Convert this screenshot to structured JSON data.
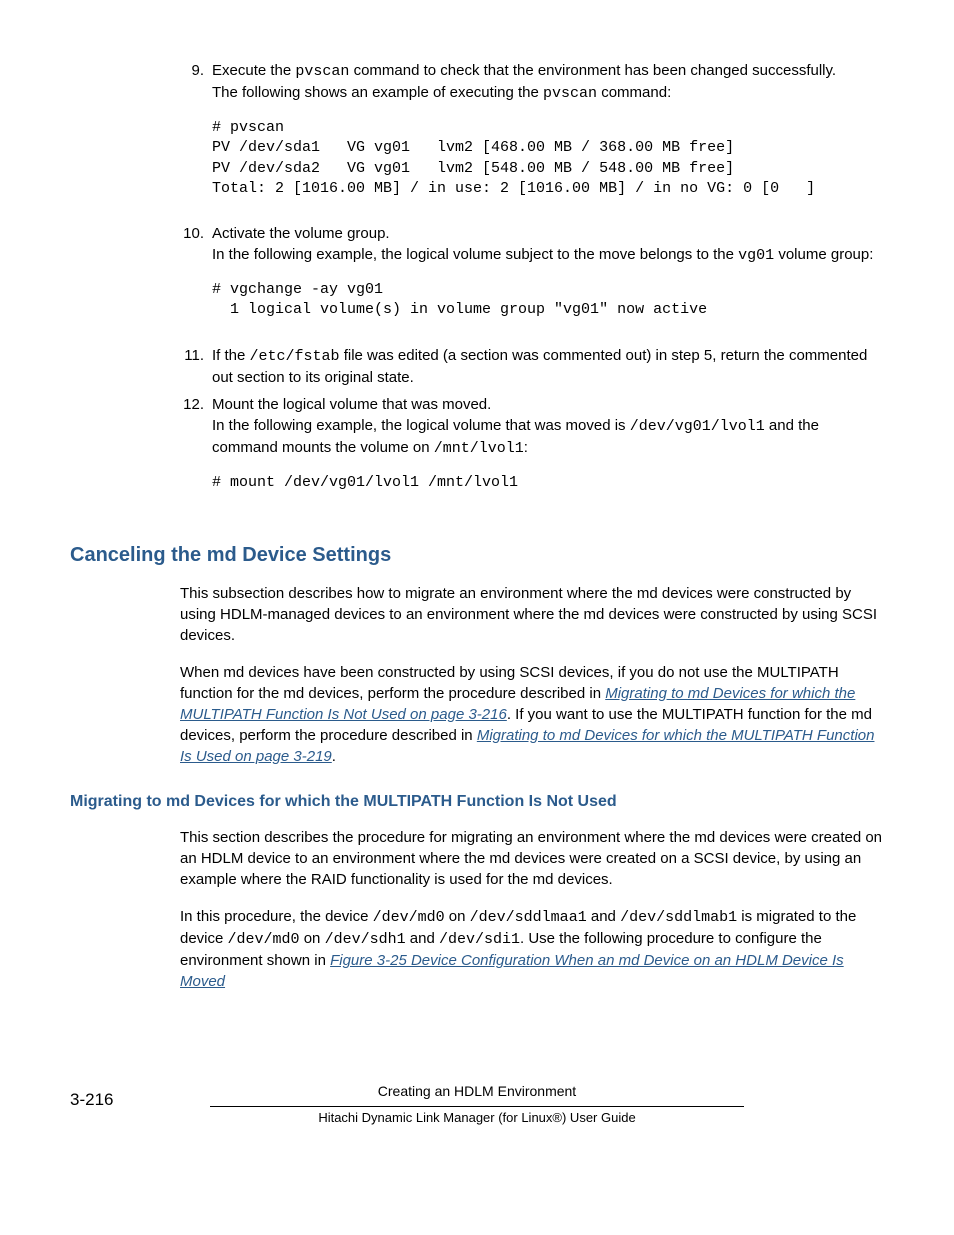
{
  "steps": {
    "s9": {
      "num": "9.",
      "p1a": "Execute the ",
      "p1code": "pvscan",
      "p1b": " command to check that the environment has been changed successfully.",
      "p2a": "The following shows an example of executing the ",
      "p2code": "pvscan",
      "p2b": " command:",
      "code": "# pvscan\nPV /dev/sda1   VG vg01   lvm2 [468.00 MB / 368.00 MB free]\nPV /dev/sda2   VG vg01   lvm2 [548.00 MB / 548.00 MB free]\nTotal: 2 [1016.00 MB] / in use: 2 [1016.00 MB] / in no VG: 0 [0   ]"
    },
    "s10": {
      "num": "10.",
      "p1": "Activate the volume group.",
      "p2a": "In the following example, the logical volume subject to the move belongs to the ",
      "p2code": "vg01",
      "p2b": " volume group:",
      "code": "# vgchange -ay vg01\n  1 logical volume(s) in volume group \"vg01\" now active"
    },
    "s11": {
      "num": "11.",
      "p1a": "If the ",
      "p1code": "/etc/fstab",
      "p1b": " file was edited (a section was commented out) in step 5, return the commented out section to its original state."
    },
    "s12": {
      "num": "12.",
      "p1": "Mount the logical volume that was moved.",
      "p2a": "In the following example, the logical volume that was moved is ",
      "p2code1": "/dev/vg01/lvol1",
      "p2b": " and the command mounts the volume on ",
      "p2code2": "/mnt/lvol1",
      "p2c": ":",
      "code": "# mount /dev/vg01/lvol1 /mnt/lvol1"
    }
  },
  "section": {
    "title": "Canceling the md Device Settings",
    "p1": "This subsection describes how to migrate an environment where the md devices were constructed by using HDLM-managed devices to an environment where the md devices were constructed by using SCSI devices.",
    "p2a": "When md devices have been constructed by using SCSI devices, if you do not use the MULTIPATH function for the md devices, perform the procedure described in ",
    "link1": "Migrating to md Devices for which the MULTIPATH Function Is Not Used on page 3-216",
    "p2b": ". If you want to use the MULTIPATH function for the md devices, perform the procedure described in ",
    "link2": "Migrating to md Devices for which the MULTIPATH Function Is Used on page 3-219",
    "p2c": "."
  },
  "subsection": {
    "title": "Migrating to md Devices for which the MULTIPATH Function Is Not Used",
    "p1": "This section describes the procedure for migrating an environment where the md devices were created on an HDLM device to an environment where the md devices were created on a SCSI device, by using an example where the RAID functionality is used for the md devices.",
    "p2a": "In this procedure, the device ",
    "c1": "/dev/md0",
    "p2b": " on ",
    "c2": "/dev/sddlmaa1",
    "p2c": " and ",
    "c3": "/dev/sddlmab1",
    "p2d": " is migrated to the device ",
    "c4": "/dev/md0",
    "p2e": " on ",
    "c5": "/dev/sdh1",
    "p2f": " and ",
    "c6": "/dev/sdi1",
    "p2g": ". Use the following procedure to configure the environment shown in ",
    "link": "Figure 3-25 Device Configuration When an md Device on an HDLM Device Is Moved"
  },
  "footer": {
    "pagenum": "3-216",
    "line1": "Creating an HDLM Environment",
    "line2": "Hitachi Dynamic Link Manager (for Linux®) User Guide"
  }
}
